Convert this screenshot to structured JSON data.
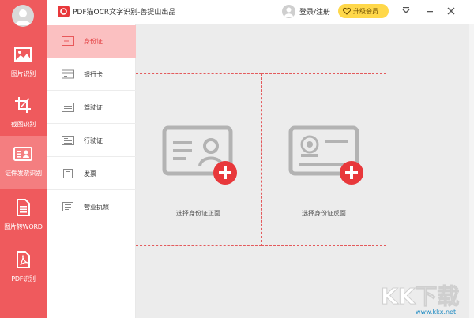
{
  "app": {
    "title": "PDF猫OCR文字识别-善提山出品",
    "login_label": "登录/注册",
    "upgrade_label": "升级会员",
    "accent": "#ef5a5d",
    "active_sub_bg": "#fbc0c1",
    "upgrade_color": "#ffd84a"
  },
  "leftnav": {
    "items": [
      {
        "label": "图片识别",
        "icon": "image-icon"
      },
      {
        "label": "截图识别",
        "icon": "crop-icon"
      },
      {
        "label": "证件发票识别",
        "icon": "id-card-icon",
        "active": true
      },
      {
        "label": "图片转WORD",
        "icon": "document-icon"
      },
      {
        "label": "PDF识别",
        "icon": "pdf-icon"
      }
    ]
  },
  "subnav": {
    "items": [
      {
        "label": "身份证",
        "icon": "id-card-icon",
        "active": true
      },
      {
        "label": "银行卡",
        "icon": "bank-card-icon"
      },
      {
        "label": "驾驶证",
        "icon": "license-icon"
      },
      {
        "label": "行驶证",
        "icon": "license-icon"
      },
      {
        "label": "发票",
        "icon": "invoice-icon"
      },
      {
        "label": "营业执照",
        "icon": "license-icon"
      }
    ]
  },
  "main": {
    "front_label": "选择身份证正面",
    "back_label": "选择身份证反面"
  },
  "watermark": {
    "text": "www.kkx.net"
  }
}
